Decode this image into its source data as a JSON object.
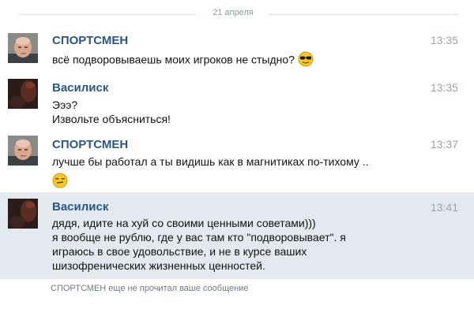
{
  "date_separator": "21 апреля",
  "messages": [
    {
      "author": "СПОРТСМЕН",
      "time": "13:35",
      "lines": [
        "всё подворовываешь моих игроков не стыдно?"
      ],
      "avatar_icon": "bald-man-avatar",
      "emoji": "sunglasses-emoji-icon",
      "highlighted": false
    },
    {
      "author": "Василиск",
      "time": "13:35",
      "lines": [
        "Эээ?",
        "Извольте объясниться!"
      ],
      "avatar_icon": "dark-avatar",
      "emoji": "",
      "highlighted": false
    },
    {
      "author": "СПОРТСМЕН",
      "time": "13:37",
      "lines": [
        "лучше бы работал а ты видишь как в магнитиках по-тихому .."
      ],
      "avatar_icon": "bald-man-avatar",
      "emoji": "smirk-emoji-icon",
      "highlighted": false
    },
    {
      "author": "Василиск",
      "time": "13:41",
      "lines": [
        "дядя, идите на хуй со своими ценными советами)))",
        "я вообще не рублю, где у вас там кто \"подворовывает\". я",
        "играюсь в свое удовольствие, и не в курсе ваших",
        "шизофренических жизненных ценностей."
      ],
      "avatar_icon": "dark-avatar",
      "emoji": "",
      "highlighted": true
    }
  ],
  "status_text": "СПОРТСМЕН еще не прочитал ваше сообщение",
  "colors": {
    "author": "#2b5788",
    "time": "#9aa3ad",
    "highlight_bg": "#e4e9ef",
    "separator": "#8e9aaa"
  }
}
